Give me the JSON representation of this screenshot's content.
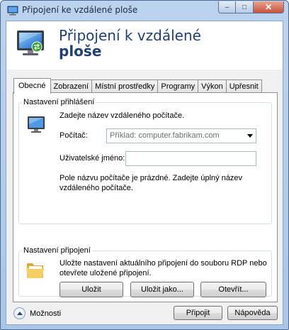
{
  "window": {
    "title": "Připojení ke vzdálené ploše",
    "minimize_glyph": "–",
    "maximize_glyph": "□",
    "close_glyph": "✕"
  },
  "banner": {
    "title_line1": "Připojení k vzdálené",
    "title_line2": "ploše",
    "icon": "remote-desktop-icon"
  },
  "tabs": [
    {
      "label": "Obecné",
      "active": true
    },
    {
      "label": "Zobrazení",
      "active": false
    },
    {
      "label": "Místní prostředky",
      "active": false
    },
    {
      "label": "Programy",
      "active": false
    },
    {
      "label": "Výkon",
      "active": false
    },
    {
      "label": "Upřesnit",
      "active": false
    }
  ],
  "login_settings": {
    "group_label": "Nastavení přihlášení",
    "instruction": "Zadejte název vzdáleného počítače.",
    "computer_label": "Počítač:",
    "computer_placeholder": "Příklad: computer.fabrikam.com",
    "username_label": "Uživatelské jméno:",
    "username_value": "",
    "message_line1": "Pole názvu počítače je prázdné. Zadejte úplný název",
    "message_line2": "vzdáleného počítače."
  },
  "connection_settings": {
    "group_label": "Nastavení připojení",
    "description_line1": "Uložte nastavení aktuálního připojení do souboru RDP nebo",
    "description_line2": "otevřete uložené připojení.",
    "save_label": "Uložit",
    "save_as_label": "Uložit jako...",
    "open_label": "Otevřít..."
  },
  "footer": {
    "options_label": "Možnosti",
    "connect_label": "Připojit",
    "help_label": "Nápověda"
  },
  "colors": {
    "accent_title": "#1e3f7a",
    "frame": "#bcd3ee"
  }
}
